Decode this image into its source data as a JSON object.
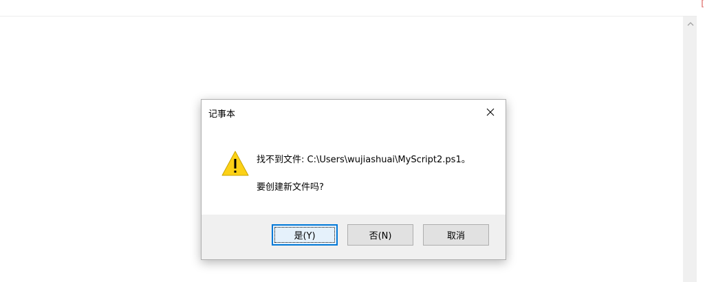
{
  "window": {
    "corner_mark": "["
  },
  "dialog": {
    "title": "记事本",
    "message_line1": "找不到文件: C:\\Users\\wujiashuai\\MyScript2.ps1。",
    "message_line2": "要创建新文件吗?",
    "close_icon": "close-icon",
    "warning_icon": "warning-icon"
  },
  "buttons": {
    "yes_label": "是(Y)",
    "no_label": "否(N)",
    "cancel_label": "取消"
  },
  "colors": {
    "accent": "#0078d7",
    "warning_fill": "#fcd116",
    "footer_bg": "#f0f0f0",
    "button_bg": "#e1e1e1"
  }
}
